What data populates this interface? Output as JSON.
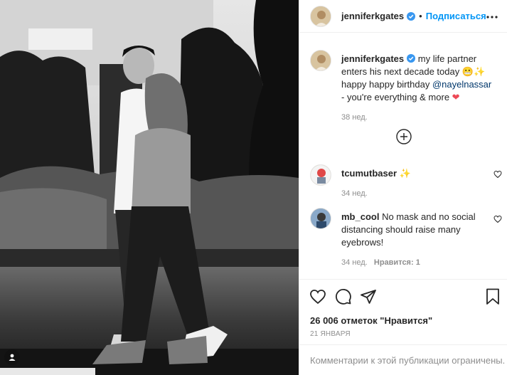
{
  "post": {
    "username": "jenniferkgates",
    "follow_label": "Подписаться",
    "separator": "•"
  },
  "caption": {
    "username": "jenniferkgates",
    "text_1": " my life partner enters his next decade today ",
    "text_2": "happy happy birthday ",
    "mention": "@nayelnassar",
    "text_3": " - you're everything & more ",
    "time": "38 нед."
  },
  "comments": [
    {
      "username": "tcumutbaser",
      "text": "",
      "time": "34 нед.",
      "likes": ""
    },
    {
      "username": "mb_cool",
      "text": " No mask and no social distancing should raise many eyebrows!",
      "time": "34 нед.",
      "likes": "Нравится: 1"
    }
  ],
  "footer": {
    "likes_label": "26 006 отметок \"Нравится\"",
    "date": "21 ЯНВАРЯ",
    "comments_closed": "Комментарии к этой публикации ограничены."
  },
  "colors": {
    "accent": "#0095f6",
    "verified": "#3897f0",
    "heart": "#ed4956",
    "muted": "#8e8e8e"
  },
  "icons": [
    "verified-badge-icon",
    "more-options-icon",
    "add-circle-icon",
    "heart-icon",
    "comment-icon",
    "share-icon",
    "bookmark-icon",
    "user-tag-icon",
    "sparkle-emoji",
    "grimace-emoji",
    "red-heart-emoji"
  ]
}
